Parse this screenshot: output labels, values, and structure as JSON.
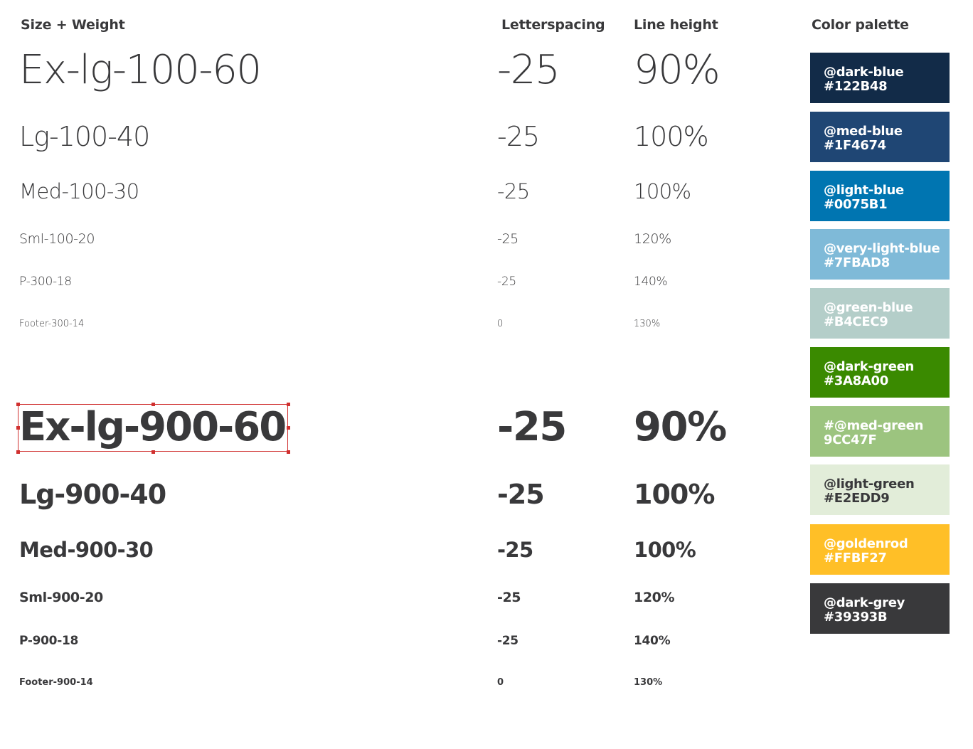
{
  "headers": {
    "size_weight": "Size + Weight",
    "letterspacing": "Letterspacing",
    "line_height": "Line height",
    "color_palette": "Color palette"
  },
  "light_rows": [
    {
      "name": "Ex-lg-100-60",
      "ls": "-25",
      "lh": "90%"
    },
    {
      "name": "Lg-100-40",
      "ls": "-25",
      "lh": "100%"
    },
    {
      "name": "Med-100-30",
      "ls": "-25",
      "lh": "100%"
    },
    {
      "name": "Sml-100-20",
      "ls": "-25",
      "lh": "120%"
    },
    {
      "name": "P-300-18",
      "ls": "-25",
      "lh": "140%"
    },
    {
      "name": "Footer-300-14",
      "ls": "0",
      "lh": "130%"
    }
  ],
  "heavy_rows": [
    {
      "name": "Ex-lg-900-60",
      "ls": "-25",
      "lh": "90%"
    },
    {
      "name": "Lg-900-40",
      "ls": "-25",
      "lh": "100%"
    },
    {
      "name": "Med-900-30",
      "ls": "-25",
      "lh": "100%"
    },
    {
      "name": "Sml-900-20",
      "ls": "-25",
      "lh": "120%"
    },
    {
      "name": "P-900-18",
      "ls": "-25",
      "lh": "140%"
    },
    {
      "name": "Footer-900-14",
      "ls": "0",
      "lh": "130%"
    }
  ],
  "palette": [
    {
      "name": "@dark-blue",
      "hex": "#122B48",
      "bg": "#122B48",
      "fg": "#ffffff"
    },
    {
      "name": "@med-blue",
      "hex": "#1F4674",
      "bg": "#1F4674",
      "fg": "#ffffff"
    },
    {
      "name": "@light-blue",
      "hex": "#0075B1",
      "bg": "#0075B1",
      "fg": "#ffffff"
    },
    {
      "name": "@very-light-blue",
      "hex": "#7FBAD8",
      "bg": "#7FBAD8",
      "fg": "#ffffff"
    },
    {
      "name": "@green-blue",
      "hex": "#B4CEC9",
      "bg": "#B4CEC9",
      "fg": "#ffffff"
    },
    {
      "name": "@dark-green",
      "hex": "#3A8A00",
      "bg": "#3A8A00",
      "fg": "#ffffff"
    },
    {
      "name": "#@med-green",
      "hex": "9CC47F",
      "bg": "#9CC47F",
      "fg": "#ffffff"
    },
    {
      "name": "@light-green",
      "hex": "#E2EDD9",
      "bg": "#E2EDD9",
      "fg": "#39393B"
    },
    {
      "name": "@goldenrod",
      "hex": "#FFBF27",
      "bg": "#FFBF27",
      "fg": "#ffffff"
    },
    {
      "name": "@dark-grey",
      "hex": "#39393B",
      "bg": "#39393B",
      "fg": "#ffffff"
    }
  ]
}
